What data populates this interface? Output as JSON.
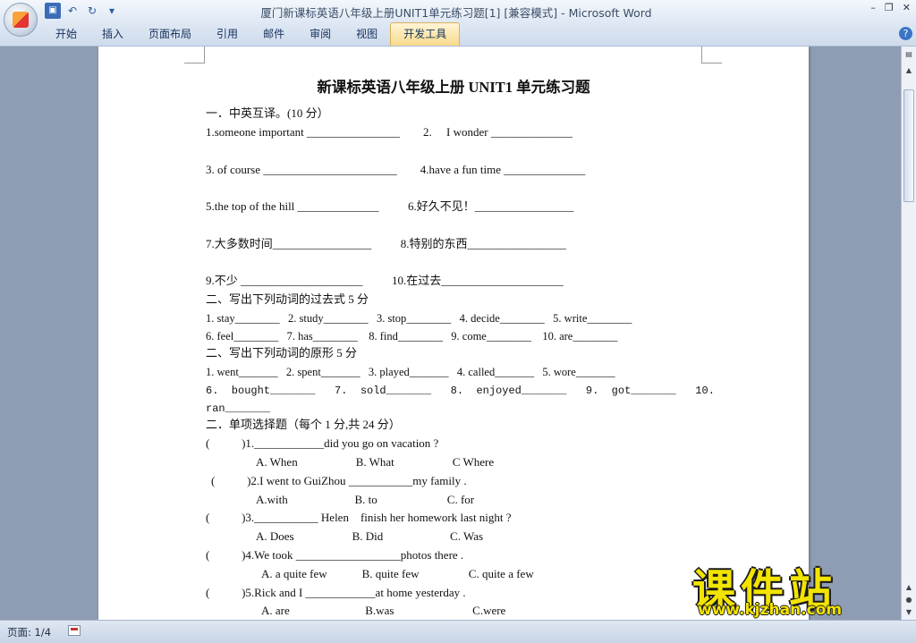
{
  "window": {
    "title": "厦门新课标英语八年级上册UNIT1单元练习题[1] [兼容模式] - Microsoft Word",
    "quick_access": [
      "save-icon",
      "undo-icon",
      "redo-icon",
      "customize-icon"
    ],
    "controls": {
      "minimize": "–",
      "restore": "❐",
      "close": "✕"
    }
  },
  "ribbon": {
    "tabs": [
      "开始",
      "插入",
      "页面布局",
      "引用",
      "邮件",
      "审阅",
      "视图",
      "开发工具"
    ],
    "active_tab": "开发工具",
    "help": "?"
  },
  "document": {
    "title": "新课标英语八年级上册 UNIT1 单元练习题",
    "lines": [
      "一．中英互译。(10 分）",
      "1.someone important ________________        2.     I wonder ______________",
      "3. of course _______________________        4.have a fun time ______________",
      "5.the top of the hill ______________          6.好久不见！_________________",
      "7.大多数时间_________________          8.特别的东西_________________",
      "9.不少 _____________________          10.在过去_____________________",
      "二、写出下列动词的过去式 5 分",
      "1. stay________   2. study________   3. stop________   4. decide________   5. write________",
      "6. feel________   7. has________    8. find________   9. come________    10. are________",
      "二、写出下列动词的原形 5 分",
      "1. went_______   2. spent_______   3. played_______   4. called_______   5. wore_______",
      "6.  bought_______   7.  sold_______   8.  enjoyed_______   9.  got_______   10.",
      "ran_______",
      "二．单项选择题（每个 1 分,共 24 分）",
      "(           )1.____________did you go on vacation ?",
      "A. When                    B. What                    C Where",
      "(           )2.I went to GuiZhou ___________my family .",
      "A.with                       B. to                        C. for",
      "(           )3.___________ Helen    finish her homework last night ?",
      "A. Does                    B. Did                       C. Was",
      "(           )4.We took __________________photos there .",
      "A. a quite few            B. quite few                 C. quite a few",
      "(           )5.Rick and I ____________at home yesterday .",
      "A. are                          B.was                           C.were"
    ]
  },
  "status": {
    "page": "页面: 1/4"
  },
  "watermark": {
    "name": "课件站",
    "url": "www.kjzhan.com"
  }
}
